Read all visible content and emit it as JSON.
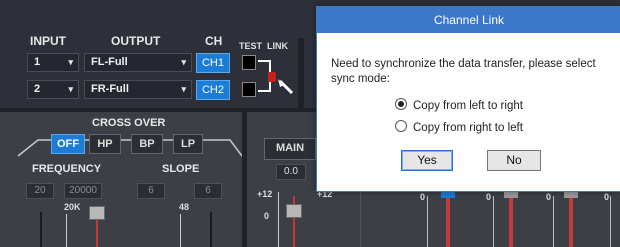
{
  "routing": {
    "headers": {
      "input": "INPUT",
      "output": "OUTPUT",
      "ch": "CH",
      "test": "TEST",
      "link": "LINK"
    },
    "rows": [
      {
        "input": "1",
        "output": "FL-Full",
        "ch": "CH1"
      },
      {
        "input": "2",
        "output": "FR-Full",
        "ch": "CH2"
      }
    ]
  },
  "crossover": {
    "title": "CROSS OVER",
    "buttons": [
      "OFF",
      "HP",
      "BP",
      "LP"
    ],
    "active": "OFF",
    "frequency_label": "FREQUENCY",
    "slope_label": "SLOPE",
    "freq_low": "20",
    "freq_high": "20000",
    "slope_low": "6",
    "slope_high": "6",
    "freq_scale_top": "20K",
    "slope_scale_top": "48"
  },
  "main": {
    "label": "MAIN",
    "value": "0.0",
    "scale_top": "+12",
    "scale_mid": "0",
    "scale_top2": "+12",
    "meter_zero": "0"
  },
  "dialog": {
    "title": "Channel Link",
    "message": "Need to synchronize the data transfer, please select sync mode:",
    "options": [
      "Copy from left to right",
      "Copy from right to left"
    ],
    "selected_index": 0,
    "yes": "Yes",
    "no": "No"
  },
  "colors": {
    "accent": "#1c7cd6",
    "dialog_title_bar": "#3c78c8",
    "fader_rail": "#c03a3a"
  }
}
